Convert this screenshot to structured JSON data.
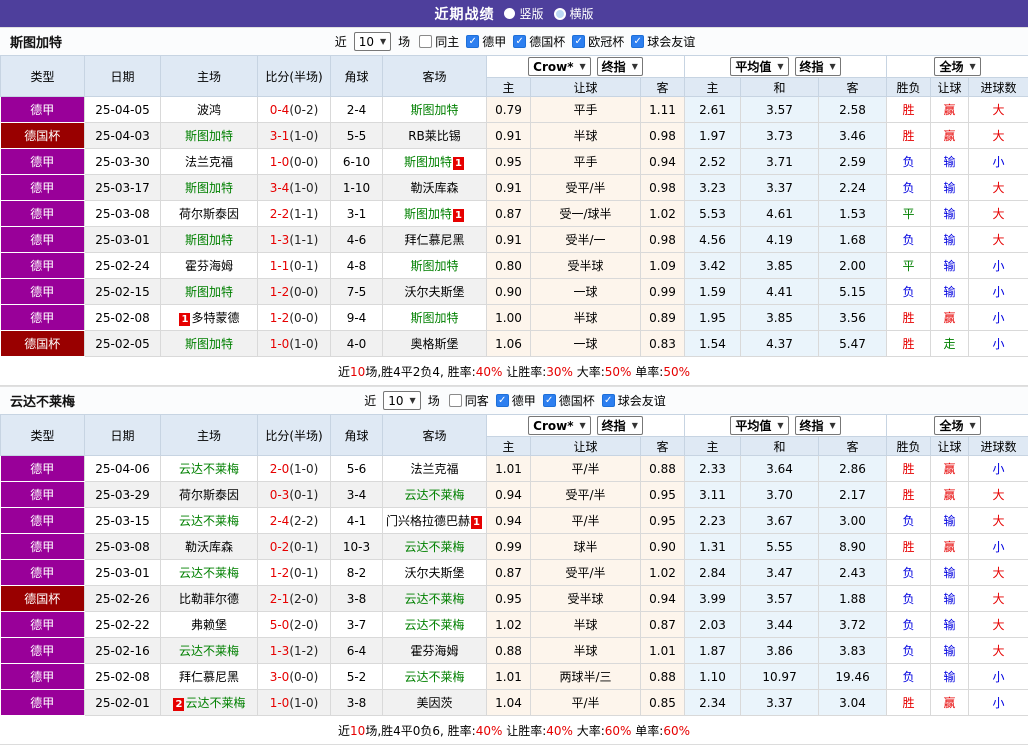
{
  "icons": {
    "chevron": "▼",
    "check": "✓"
  },
  "colors": {
    "accent": "#4e3f9c",
    "league_purple": "#990099",
    "league_cup": "#990000",
    "focus_team_green": "#008000",
    "win_red": "#e60000",
    "lose_blue": "#0000e0",
    "draw_green": "#008000"
  },
  "top_bar": {
    "title": "近期战绩",
    "options": [
      {
        "label": "竖版",
        "selected": true
      },
      {
        "label": "横版",
        "selected": false
      }
    ]
  },
  "table_header": {
    "static_cols": [
      "类型",
      "日期",
      "主场",
      "比分(半场)",
      "角球",
      "客场"
    ],
    "dropdowns": {
      "crow": "Crow*",
      "final1": "终指",
      "avg": "平均值",
      "final2": "终指",
      "full": "全场"
    },
    "sub_cols_crow": [
      "主",
      "让球",
      "客"
    ],
    "sub_cols_avg": [
      "主",
      "和",
      "客"
    ],
    "sub_cols_result": [
      "胜负",
      "让球",
      "进球数"
    ]
  },
  "sections": [
    {
      "team": "斯图加特",
      "filters": {
        "pre": "近",
        "count": "10",
        "post": "场",
        "same": "同主",
        "same_checked": false,
        "leagues": [
          {
            "label": "德甲",
            "checked": true
          },
          {
            "label": "德国杯",
            "checked": true
          },
          {
            "label": "欧冠杯",
            "checked": true
          },
          {
            "label": "球会友谊",
            "checked": true
          }
        ]
      },
      "rows": [
        {
          "league": "德甲",
          "lc": "purple",
          "date": "25-04-05",
          "home": {
            "name": "波鸿",
            "focus": false
          },
          "score": "0-4",
          "half": "(0-2)",
          "corner": "2-4",
          "away": {
            "name": "斯图加特",
            "focus": true
          },
          "crow": [
            "0.79",
            "平手",
            "1.11"
          ],
          "avg": [
            "2.61",
            "3.57",
            "2.58"
          ],
          "res": [
            {
              "t": "胜",
              "c": "r"
            },
            {
              "t": "赢",
              "c": "r"
            },
            {
              "t": "大",
              "c": "r"
            }
          ]
        },
        {
          "league": "德国杯",
          "lc": "cup",
          "date": "25-04-03",
          "home": {
            "name": "斯图加特",
            "focus": true
          },
          "score": "3-1",
          "half": "(1-0)",
          "corner": "5-5",
          "away": {
            "name": "RB莱比锡",
            "focus": false
          },
          "crow": [
            "0.91",
            "半球",
            "0.98"
          ],
          "avg": [
            "1.97",
            "3.73",
            "3.46"
          ],
          "res": [
            {
              "t": "胜",
              "c": "r"
            },
            {
              "t": "赢",
              "c": "r"
            },
            {
              "t": "大",
              "c": "r"
            }
          ]
        },
        {
          "league": "德甲",
          "lc": "purple",
          "date": "25-03-30",
          "home": {
            "name": "法兰克福",
            "focus": false
          },
          "score": "1-0",
          "half": "(0-0)",
          "corner": "6-10",
          "away": {
            "name": "斯图加特",
            "focus": true,
            "badge": "1",
            "pos": "after"
          },
          "crow": [
            "0.95",
            "平手",
            "0.94"
          ],
          "avg": [
            "2.52",
            "3.71",
            "2.59"
          ],
          "res": [
            {
              "t": "负",
              "c": "b"
            },
            {
              "t": "输",
              "c": "b"
            },
            {
              "t": "小",
              "c": "b"
            }
          ]
        },
        {
          "league": "德甲",
          "lc": "purple",
          "date": "25-03-17",
          "home": {
            "name": "斯图加特",
            "focus": true
          },
          "score": "3-4",
          "half": "(1-0)",
          "corner": "1-10",
          "away": {
            "name": "勒沃库森",
            "focus": false
          },
          "crow": [
            "0.91",
            "受平/半",
            "0.98"
          ],
          "avg": [
            "3.23",
            "3.37",
            "2.24"
          ],
          "res": [
            {
              "t": "负",
              "c": "b"
            },
            {
              "t": "输",
              "c": "b"
            },
            {
              "t": "大",
              "c": "r"
            }
          ]
        },
        {
          "league": "德甲",
          "lc": "purple",
          "date": "25-03-08",
          "home": {
            "name": "荷尔斯泰因",
            "focus": false
          },
          "score": "2-2",
          "half": "(1-1)",
          "corner": "3-1",
          "away": {
            "name": "斯图加特",
            "focus": true,
            "badge": "1",
            "pos": "after"
          },
          "crow": [
            "0.87",
            "受一/球半",
            "1.02"
          ],
          "avg": [
            "5.53",
            "4.61",
            "1.53"
          ],
          "res": [
            {
              "t": "平",
              "c": "g"
            },
            {
              "t": "输",
              "c": "b"
            },
            {
              "t": "大",
              "c": "r"
            }
          ]
        },
        {
          "league": "德甲",
          "lc": "purple",
          "date": "25-03-01",
          "home": {
            "name": "斯图加特",
            "focus": true
          },
          "score": "1-3",
          "half": "(1-1)",
          "corner": "4-6",
          "away": {
            "name": "拜仁慕尼黑",
            "focus": false
          },
          "crow": [
            "0.91",
            "受半/一",
            "0.98"
          ],
          "avg": [
            "4.56",
            "4.19",
            "1.68"
          ],
          "res": [
            {
              "t": "负",
              "c": "b"
            },
            {
              "t": "输",
              "c": "b"
            },
            {
              "t": "大",
              "c": "r"
            }
          ]
        },
        {
          "league": "德甲",
          "lc": "purple",
          "date": "25-02-24",
          "home": {
            "name": "霍芬海姆",
            "focus": false
          },
          "score": "1-1",
          "half": "(0-1)",
          "corner": "4-8",
          "away": {
            "name": "斯图加特",
            "focus": true
          },
          "crow": [
            "0.80",
            "受半球",
            "1.09"
          ],
          "avg": [
            "3.42",
            "3.85",
            "2.00"
          ],
          "res": [
            {
              "t": "平",
              "c": "g"
            },
            {
              "t": "输",
              "c": "b"
            },
            {
              "t": "小",
              "c": "b"
            }
          ]
        },
        {
          "league": "德甲",
          "lc": "purple",
          "date": "25-02-15",
          "home": {
            "name": "斯图加特",
            "focus": true
          },
          "score": "1-2",
          "half": "(0-0)",
          "corner": "7-5",
          "away": {
            "name": "沃尔夫斯堡",
            "focus": false
          },
          "crow": [
            "0.90",
            "一球",
            "0.99"
          ],
          "avg": [
            "1.59",
            "4.41",
            "5.15"
          ],
          "res": [
            {
              "t": "负",
              "c": "b"
            },
            {
              "t": "输",
              "c": "b"
            },
            {
              "t": "小",
              "c": "b"
            }
          ]
        },
        {
          "league": "德甲",
          "lc": "purple",
          "date": "25-02-08",
          "home": {
            "name": "多特蒙德",
            "focus": false,
            "badge": "1",
            "pos": "before"
          },
          "score": "1-2",
          "half": "(0-0)",
          "corner": "9-4",
          "away": {
            "name": "斯图加特",
            "focus": true
          },
          "crow": [
            "1.00",
            "半球",
            "0.89"
          ],
          "avg": [
            "1.95",
            "3.85",
            "3.56"
          ],
          "res": [
            {
              "t": "胜",
              "c": "r"
            },
            {
              "t": "赢",
              "c": "r"
            },
            {
              "t": "小",
              "c": "b"
            }
          ]
        },
        {
          "league": "德国杯",
          "lc": "cup",
          "date": "25-02-05",
          "home": {
            "name": "斯图加特",
            "focus": true
          },
          "score": "1-0",
          "half": "(1-0)",
          "corner": "4-0",
          "away": {
            "name": "奥格斯堡",
            "focus": false
          },
          "crow": [
            "1.06",
            "一球",
            "0.83"
          ],
          "avg": [
            "1.54",
            "4.37",
            "5.47"
          ],
          "res": [
            {
              "t": "胜",
              "c": "r"
            },
            {
              "t": "走",
              "c": "g"
            },
            {
              "t": "小",
              "c": "b"
            }
          ]
        }
      ],
      "summary": [
        {
          "t": "近"
        },
        {
          "t": "10",
          "red": true
        },
        {
          "t": "场,胜4平2负4, 胜率:"
        },
        {
          "t": "40%",
          "red": true
        },
        {
          "t": " 让胜率:"
        },
        {
          "t": "30%",
          "red": true
        },
        {
          "t": " 大率:"
        },
        {
          "t": "50%",
          "red": true
        },
        {
          "t": " 单率:"
        },
        {
          "t": "50%",
          "red": true
        }
      ]
    },
    {
      "team": "云达不莱梅",
      "filters": {
        "pre": "近",
        "count": "10",
        "post": "场",
        "same": "同客",
        "same_checked": false,
        "leagues": [
          {
            "label": "德甲",
            "checked": true
          },
          {
            "label": "德国杯",
            "checked": true
          },
          {
            "label": "球会友谊",
            "checked": true
          }
        ]
      },
      "rows": [
        {
          "league": "德甲",
          "lc": "purple",
          "date": "25-04-06",
          "home": {
            "name": "云达不莱梅",
            "focus": true
          },
          "score": "2-0",
          "half": "(1-0)",
          "corner": "5-6",
          "away": {
            "name": "法兰克福",
            "focus": false
          },
          "crow": [
            "1.01",
            "平/半",
            "0.88"
          ],
          "avg": [
            "2.33",
            "3.64",
            "2.86"
          ],
          "res": [
            {
              "t": "胜",
              "c": "r"
            },
            {
              "t": "赢",
              "c": "r"
            },
            {
              "t": "小",
              "c": "b"
            }
          ]
        },
        {
          "league": "德甲",
          "lc": "purple",
          "date": "25-03-29",
          "home": {
            "name": "荷尔斯泰因",
            "focus": false
          },
          "score": "0-3",
          "half": "(0-1)",
          "corner": "3-4",
          "away": {
            "name": "云达不莱梅",
            "focus": true
          },
          "crow": [
            "0.94",
            "受平/半",
            "0.95"
          ],
          "avg": [
            "3.11",
            "3.70",
            "2.17"
          ],
          "res": [
            {
              "t": "胜",
              "c": "r"
            },
            {
              "t": "赢",
              "c": "r"
            },
            {
              "t": "大",
              "c": "r"
            }
          ]
        },
        {
          "league": "德甲",
          "lc": "purple",
          "date": "25-03-15",
          "home": {
            "name": "云达不莱梅",
            "focus": true
          },
          "score": "2-4",
          "half": "(2-2)",
          "corner": "4-1",
          "away": {
            "name": "门兴格拉德巴赫",
            "focus": false,
            "badge": "1",
            "pos": "after"
          },
          "crow": [
            "0.94",
            "平/半",
            "0.95"
          ],
          "avg": [
            "2.23",
            "3.67",
            "3.00"
          ],
          "res": [
            {
              "t": "负",
              "c": "b"
            },
            {
              "t": "输",
              "c": "b"
            },
            {
              "t": "大",
              "c": "r"
            }
          ]
        },
        {
          "league": "德甲",
          "lc": "purple",
          "date": "25-03-08",
          "home": {
            "name": "勒沃库森",
            "focus": false
          },
          "score": "0-2",
          "half": "(0-1)",
          "corner": "10-3",
          "away": {
            "name": "云达不莱梅",
            "focus": true
          },
          "crow": [
            "0.99",
            "球半",
            "0.90"
          ],
          "avg": [
            "1.31",
            "5.55",
            "8.90"
          ],
          "res": [
            {
              "t": "胜",
              "c": "r"
            },
            {
              "t": "赢",
              "c": "r"
            },
            {
              "t": "小",
              "c": "b"
            }
          ]
        },
        {
          "league": "德甲",
          "lc": "purple",
          "date": "25-03-01",
          "home": {
            "name": "云达不莱梅",
            "focus": true
          },
          "score": "1-2",
          "half": "(0-1)",
          "corner": "8-2",
          "away": {
            "name": "沃尔夫斯堡",
            "focus": false
          },
          "crow": [
            "0.87",
            "受平/半",
            "1.02"
          ],
          "avg": [
            "2.84",
            "3.47",
            "2.43"
          ],
          "res": [
            {
              "t": "负",
              "c": "b"
            },
            {
              "t": "输",
              "c": "b"
            },
            {
              "t": "大",
              "c": "r"
            }
          ]
        },
        {
          "league": "德国杯",
          "lc": "cup",
          "date": "25-02-26",
          "home": {
            "name": "比勒菲尔德",
            "focus": false
          },
          "score": "2-1",
          "half": "(2-0)",
          "corner": "3-8",
          "away": {
            "name": "云达不莱梅",
            "focus": true
          },
          "crow": [
            "0.95",
            "受半球",
            "0.94"
          ],
          "avg": [
            "3.99",
            "3.57",
            "1.88"
          ],
          "res": [
            {
              "t": "负",
              "c": "b"
            },
            {
              "t": "输",
              "c": "b"
            },
            {
              "t": "大",
              "c": "r"
            }
          ]
        },
        {
          "league": "德甲",
          "lc": "purple",
          "date": "25-02-22",
          "home": {
            "name": "弗赖堡",
            "focus": false
          },
          "score": "5-0",
          "half": "(2-0)",
          "corner": "3-7",
          "away": {
            "name": "云达不莱梅",
            "focus": true
          },
          "crow": [
            "1.02",
            "半球",
            "0.87"
          ],
          "avg": [
            "2.03",
            "3.44",
            "3.72"
          ],
          "res": [
            {
              "t": "负",
              "c": "b"
            },
            {
              "t": "输",
              "c": "b"
            },
            {
              "t": "大",
              "c": "r"
            }
          ]
        },
        {
          "league": "德甲",
          "lc": "purple",
          "date": "25-02-16",
          "home": {
            "name": "云达不莱梅",
            "focus": true
          },
          "score": "1-3",
          "half": "(1-2)",
          "corner": "6-4",
          "away": {
            "name": "霍芬海姆",
            "focus": false
          },
          "crow": [
            "0.88",
            "半球",
            "1.01"
          ],
          "avg": [
            "1.87",
            "3.86",
            "3.83"
          ],
          "res": [
            {
              "t": "负",
              "c": "b"
            },
            {
              "t": "输",
              "c": "b"
            },
            {
              "t": "大",
              "c": "r"
            }
          ]
        },
        {
          "league": "德甲",
          "lc": "purple",
          "date": "25-02-08",
          "home": {
            "name": "拜仁慕尼黑",
            "focus": false
          },
          "score": "3-0",
          "half": "(0-0)",
          "corner": "5-2",
          "away": {
            "name": "云达不莱梅",
            "focus": true
          },
          "crow": [
            "1.01",
            "两球半/三",
            "0.88"
          ],
          "avg": [
            "1.10",
            "10.97",
            "19.46"
          ],
          "res": [
            {
              "t": "负",
              "c": "b"
            },
            {
              "t": "输",
              "c": "b"
            },
            {
              "t": "小",
              "c": "b"
            }
          ]
        },
        {
          "league": "德甲",
          "lc": "purple",
          "date": "25-02-01",
          "home": {
            "name": "云达不莱梅",
            "focus": true,
            "badge": "2",
            "pos": "before"
          },
          "score": "1-0",
          "half": "(1-0)",
          "corner": "3-8",
          "away": {
            "name": "美因茨",
            "focus": false
          },
          "crow": [
            "1.04",
            "平/半",
            "0.85"
          ],
          "avg": [
            "2.34",
            "3.37",
            "3.04"
          ],
          "res": [
            {
              "t": "胜",
              "c": "r"
            },
            {
              "t": "赢",
              "c": "r"
            },
            {
              "t": "小",
              "c": "b"
            }
          ]
        }
      ],
      "summary": [
        {
          "t": "近"
        },
        {
          "t": "10",
          "red": true
        },
        {
          "t": "场,胜4平0负6, 胜率:"
        },
        {
          "t": "40%",
          "red": true
        },
        {
          "t": " 让胜率:"
        },
        {
          "t": "40%",
          "red": true
        },
        {
          "t": " 大率:"
        },
        {
          "t": "60%",
          "red": true
        },
        {
          "t": " 单率:"
        },
        {
          "t": "60%",
          "red": true
        }
      ]
    }
  ]
}
